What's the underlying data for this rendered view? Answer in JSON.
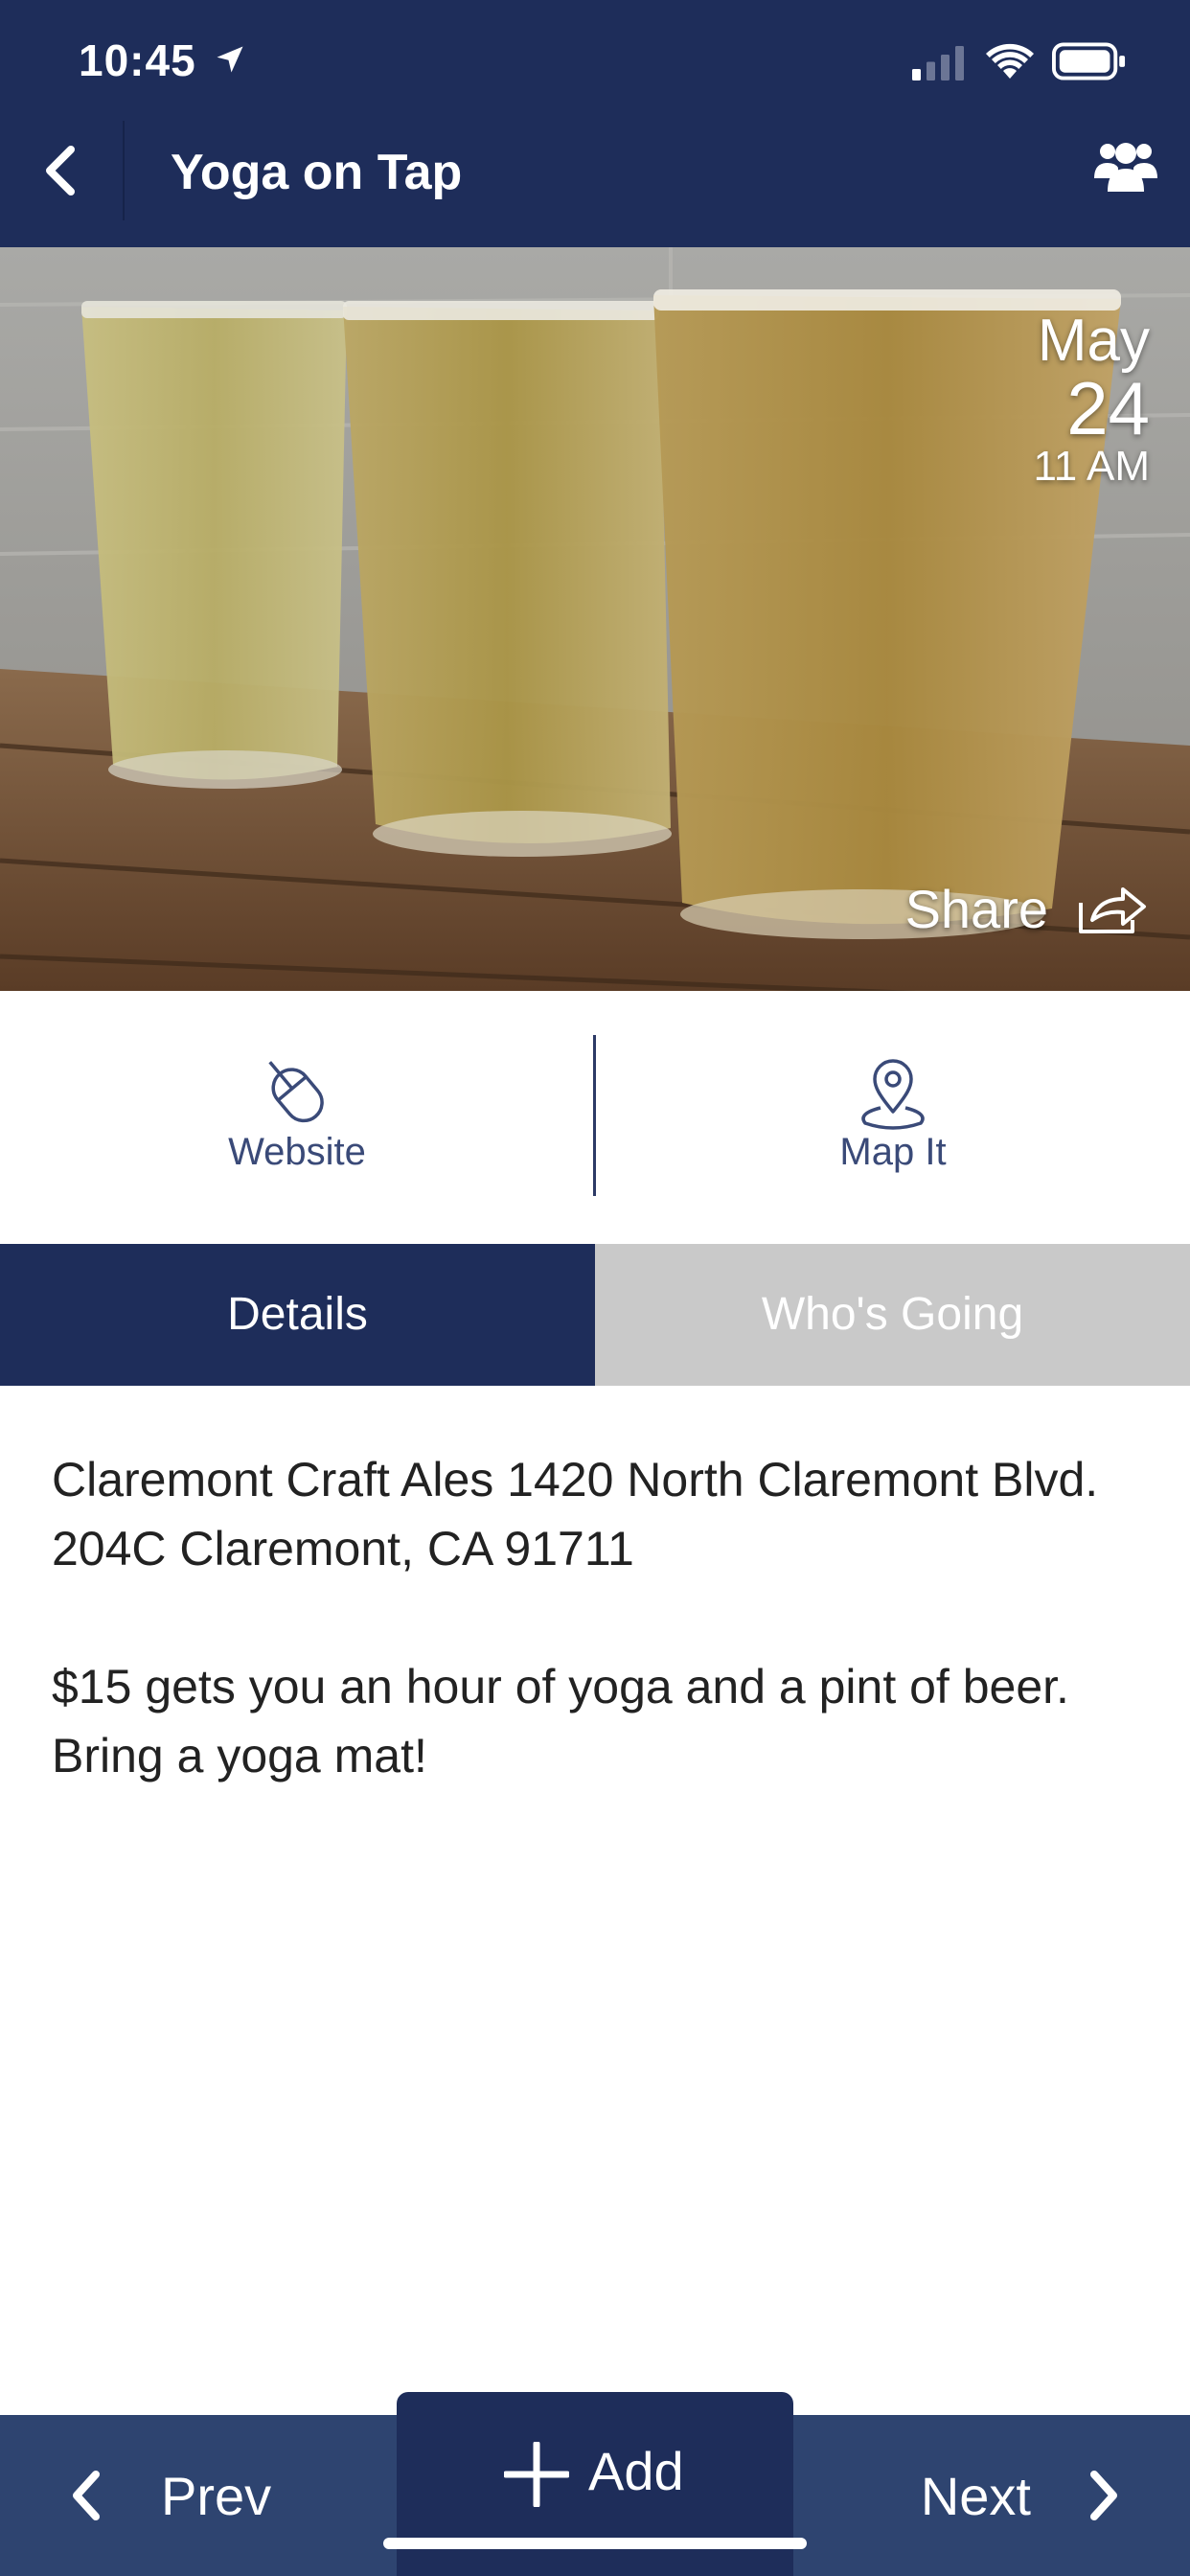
{
  "status_bar": {
    "time": "10:45"
  },
  "nav": {
    "title": "Yoga on Tap"
  },
  "event": {
    "month": "May",
    "day": "24",
    "time": "11 AM",
    "share_label": "Share"
  },
  "actions": {
    "website_label": "Website",
    "map_label": "Map It"
  },
  "tabs": [
    {
      "label": "Details",
      "active": true
    },
    {
      "label": "Who's Going",
      "active": false
    }
  ],
  "details": {
    "address": "Claremont Craft Ales 1420 North Claremont Blvd. 204C Claremont, CA 91711",
    "description": "$15 gets you an hour of yoga and a pint of beer. Bring a yoga mat!"
  },
  "bottom_bar": {
    "prev_label": "Prev",
    "add_label": "Add",
    "next_label": "Next"
  },
  "colors": {
    "primary": "#1e2d5a",
    "bottom_bar": "#2e4470",
    "inactive_tab": "#c9c9c9",
    "accent_text": "#3a4a78"
  },
  "icons": {
    "location": "location-arrow-icon",
    "signal": "cellular-signal-icon",
    "wifi": "wifi-icon",
    "battery": "battery-icon",
    "back": "chevron-left-icon",
    "group": "group-icon",
    "share": "share-icon",
    "website": "mouse-icon",
    "map": "map-pin-icon",
    "add": "plus-icon",
    "prev": "chevron-left-icon",
    "next": "chevron-right-icon"
  }
}
